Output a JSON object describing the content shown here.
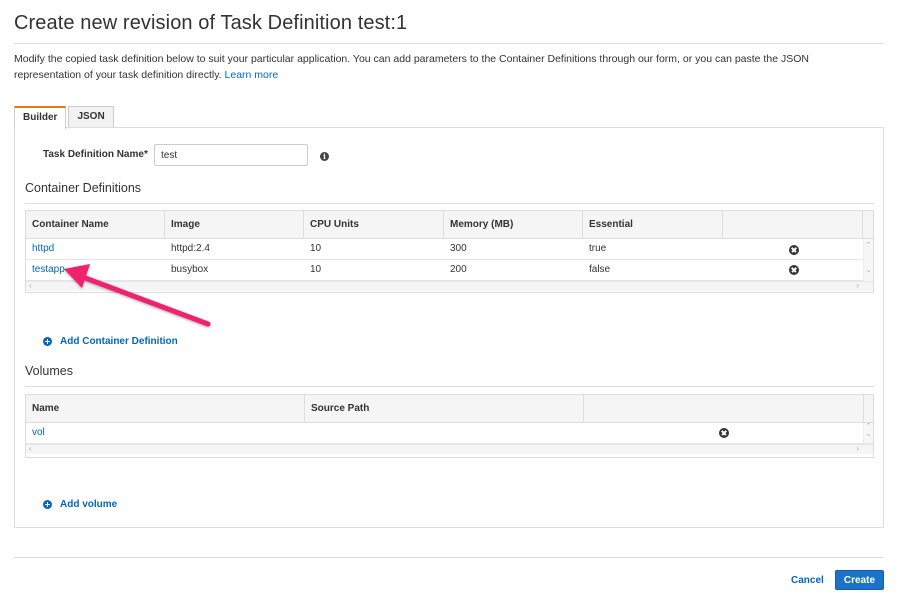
{
  "page": {
    "title": "Create new revision of Task Definition test:1",
    "description": "Modify the copied task definition below to suit your particular application. You can add parameters to the Container Definitions through our form, or you can paste the JSON representation of your task definition directly.",
    "learn_more": "Learn more"
  },
  "tabs": [
    {
      "label": "Builder",
      "active": true
    },
    {
      "label": "JSON",
      "active": false
    }
  ],
  "task_definition_name": {
    "label": "Task Definition Name*",
    "value": "test",
    "info_icon": "info-icon"
  },
  "container_definitions": {
    "heading": "Container Definitions",
    "columns": [
      "Container Name",
      "Image",
      "CPU Units",
      "Memory (MB)",
      "Essential"
    ],
    "rows": [
      {
        "name": "httpd",
        "image": "httpd:2.4",
        "cpu": "10",
        "memory": "300",
        "essential": "true"
      },
      {
        "name": "testapp",
        "image": "busybox",
        "cpu": "10",
        "memory": "200",
        "essential": "false"
      }
    ],
    "add_label": "Add Container Definition"
  },
  "volumes": {
    "heading": "Volumes",
    "columns": [
      "Name",
      "Source Path"
    ],
    "rows": [
      {
        "name": "vol",
        "source_path": ""
      }
    ],
    "add_label": "Add volume"
  },
  "footer": {
    "cancel_label": "Cancel",
    "create_label": "Create"
  },
  "colors": {
    "link": "#0066c0",
    "primary_button": "#1a73c8",
    "active_tab_accent": "#e47911",
    "annotation_arrow": "#f0246e"
  }
}
